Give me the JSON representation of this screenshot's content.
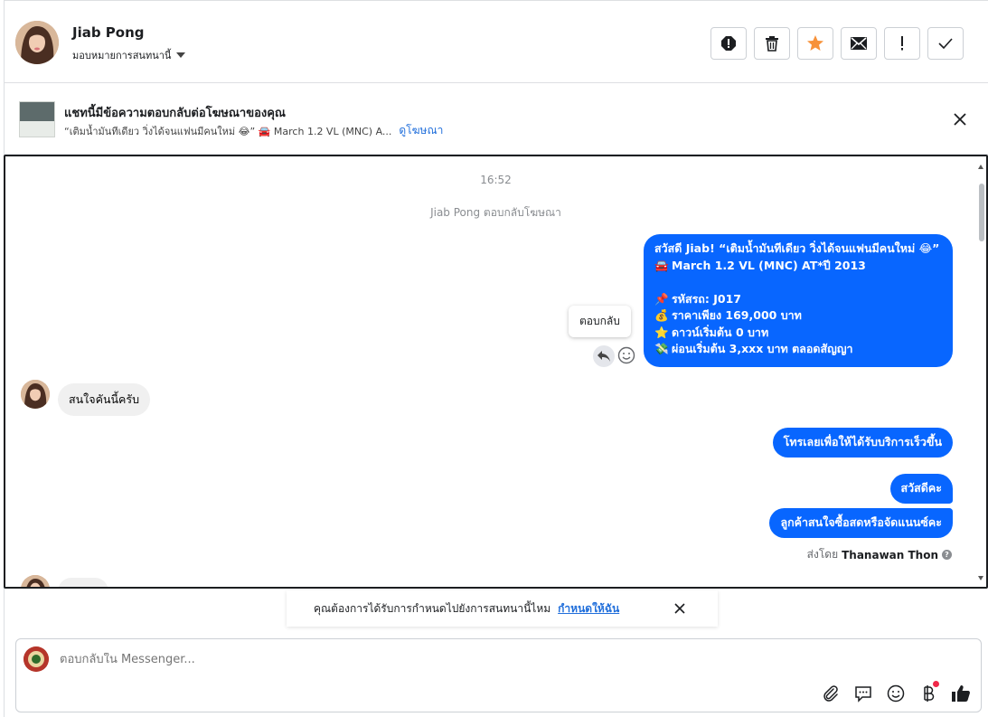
{
  "header": {
    "contact_name": "Jiab Pong",
    "assign_label": "มอบหมายการสนทนานี้",
    "actions": [
      "report-icon",
      "trash-icon",
      "star-icon",
      "mail-icon",
      "exclamation-icon",
      "check-icon"
    ],
    "star_color": "#f7923a"
  },
  "ad_banner": {
    "title": "แชทนี้มีข้อความตอบกลับต่อโฆษณาของคุณ",
    "subtitle": "“เติมน้ำมันทีเดียว วิ่งได้จนแฟนมีคนใหม่ 😂” 🚘 March 1.2 VL (MNC) A...",
    "link": "ดูโฆษณา"
  },
  "chat": {
    "time": "16:52",
    "system_message": "Jiab Pong ตอบกลับโฆษณา",
    "ad_message_lines": [
      {
        "emoji": "",
        "text": "สวัสดี Jiab! “เติมน้ำมันทีเดียว วิ่งได้จนแฟนมีคนใหม่ 😂”"
      },
      {
        "emoji": "🚘",
        "text": "March 1.2 VL (MNC) AT*ปี 2013"
      },
      {
        "emoji": "",
        "text": ""
      },
      {
        "emoji": "📌",
        "text": "รหัสรถ: J017"
      },
      {
        "emoji": "💰",
        "text": "ราคาเพียง 169,000 บาท"
      },
      {
        "emoji": "⭐",
        "text": "ดาวน์เริ่มต้น 0 บาท"
      },
      {
        "emoji": "💸",
        "text": "ผ่อนเริ่มต้น 3,xxx บาท ตลอดสัญญา"
      }
    ],
    "reply_tooltip": "ตอบกลับ",
    "incoming_1": "สนใจคันนี้ครับ",
    "outgoing_1": "โทรเลยเพื่อให้ได้รับบริการเร็วขึ้น",
    "outgoing_2": "สวัสดีคะ",
    "outgoing_3": "ลูกค้าสนใจซื้อสดหรือจัดแนนซ์คะ",
    "sent_by_prefix": "ส่งโดย",
    "sent_by_name": "Thanawan Thon",
    "accent_color": "#0866ff"
  },
  "toast": {
    "text": "คุณต้องการได้รับการกำหนดไปยังการสนทนานี้ไหม",
    "link": "กำหนดให้ฉัน"
  },
  "composer": {
    "placeholder": "ตอบกลับใน Messenger...",
    "tools": [
      "paperclip-icon",
      "saved-reply-icon",
      "emoji-icon",
      "baht-icon",
      "thumbs-up-icon"
    ]
  }
}
